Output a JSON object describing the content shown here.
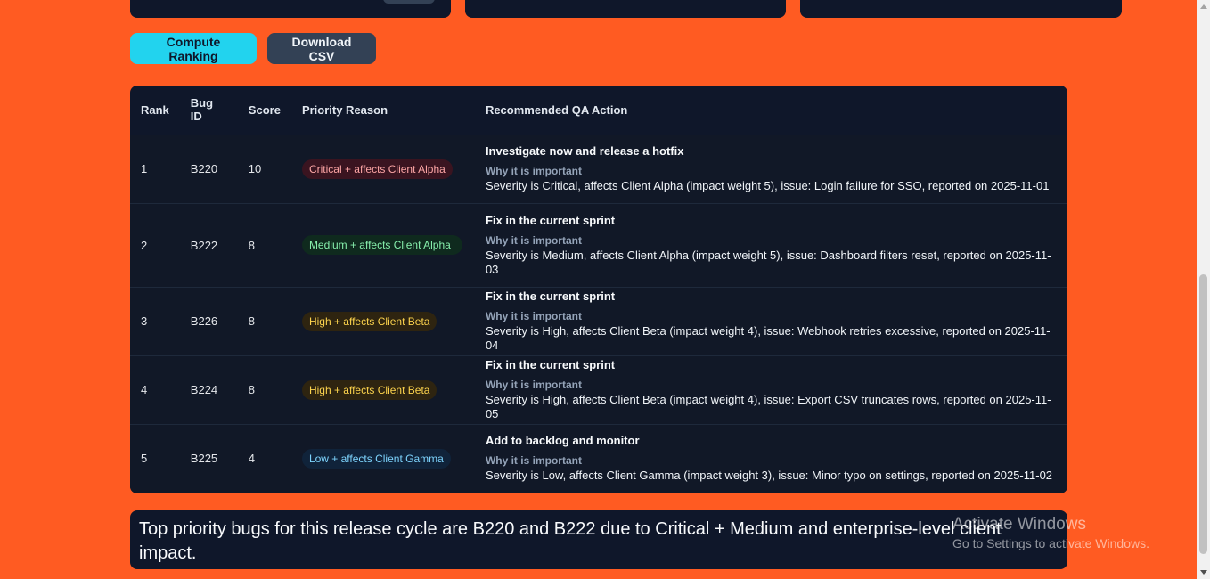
{
  "toolbar": {
    "compute_label": "Compute Ranking",
    "download_label": "Download CSV"
  },
  "table": {
    "headers": {
      "rank": "Rank",
      "bug_id": "Bug ID",
      "score": "Score",
      "reason": "Priority Reason",
      "action": "Recommended QA Action"
    },
    "rows": [
      {
        "rank": "1",
        "bug_id": "B220",
        "score": "10",
        "reason": "Critical + affects Client Alpha",
        "action_title": "Investigate now and release a hotfix",
        "why": "Why it is important",
        "detail": "Severity is Critical, affects Client Alpha (impact weight 5), issue: Login failure for SSO, reported on 2025-11-01"
      },
      {
        "rank": "2",
        "bug_id": "B222",
        "score": "8",
        "reason": "Medium + affects Client Alpha",
        "action_title": "Fix in the current sprint",
        "why": "Why it is important",
        "detail": "Severity is Medium, affects Client Alpha (impact weight 5), issue: Dashboard filters reset, reported on 2025-11-03"
      },
      {
        "rank": "3",
        "bug_id": "B226",
        "score": "8",
        "reason": "High + affects Client Beta",
        "action_title": "Fix in the current sprint",
        "why": "Why it is important",
        "detail": "Severity is High, affects Client Beta (impact weight 4), issue: Webhook retries excessive, reported on 2025-11-04"
      },
      {
        "rank": "4",
        "bug_id": "B224",
        "score": "8",
        "reason": "High + affects Client Beta",
        "action_title": "Fix in the current sprint",
        "why": "Why it is important",
        "detail": "Severity is High, affects Client Beta (impact weight 4), issue: Export CSV truncates rows, reported on 2025-11-05"
      },
      {
        "rank": "5",
        "bug_id": "B225",
        "score": "4",
        "reason": "Low + affects Client Gamma",
        "action_title": "Add to backlog and monitor",
        "why": "Why it is important",
        "detail": "Severity is Low, affects Client Gamma (impact weight 3), issue: Minor typo on settings, reported on 2025-11-02"
      }
    ]
  },
  "summary": {
    "text": "Top priority bugs for this release cycle are B220 and B222 due to Critical + Medium and enterprise-level client impact."
  },
  "watermark": {
    "title": "Activate Windows",
    "subtitle": "Go to Settings to activate Windows."
  },
  "colors": {
    "page_background": "#ff5b22",
    "panel": "#0f172a",
    "accent": "#22d3ee",
    "critical": "#fca5a5",
    "medium": "#86efac",
    "high": "#fcd34d",
    "low": "#7dd3fc"
  }
}
